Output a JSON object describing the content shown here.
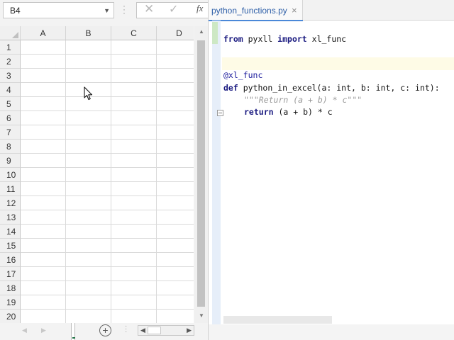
{
  "excel": {
    "name_box": {
      "value": "B4"
    },
    "formula_bar": {
      "cancel_icon": "x-icon",
      "enter_icon": "check-icon",
      "fx_label": "fx",
      "value": ""
    },
    "columns": [
      "A",
      "B",
      "C",
      "D"
    ],
    "rows": [
      "1",
      "2",
      "3",
      "4",
      "5",
      "6",
      "7",
      "8",
      "9",
      "10",
      "11",
      "12",
      "13",
      "14",
      "15",
      "16",
      "17",
      "18",
      "19",
      "20"
    ],
    "selected_cell": "B4",
    "add_sheet_icon": "plus-circle-icon"
  },
  "editor": {
    "tab": {
      "label": "python_functions.py",
      "close": "×"
    },
    "code": {
      "line1": {
        "kw1": "from",
        "text1": " pyxll ",
        "kw2": "import",
        "text2": " xl_func"
      },
      "line2": {
        "decorator": "@xl_func"
      },
      "line3": {
        "kw": "def",
        "text": " python_in_excel(a: int, b: int, c: int):"
      },
      "line4": {
        "docstring": "\"\"\"Return (a + b) * c\"\"\""
      },
      "line5": {
        "kw": "return",
        "text": " (a + b) * c"
      }
    }
  },
  "colors": {
    "excel_green": "#217346",
    "keyword": "#1a1a80",
    "docstring": "#9a9a9a",
    "tab_blue": "#2e5fa8"
  }
}
